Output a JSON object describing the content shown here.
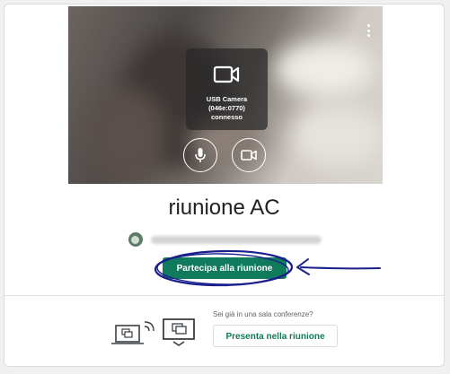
{
  "video": {
    "camera_name": "USB Camera",
    "camera_id": "(046e:0770)",
    "camera_status": "connesso",
    "mic_icon": "microphone-icon",
    "cam_icon": "video-camera-icon",
    "menu_icon": "more-vert-icon"
  },
  "meeting": {
    "title": "riunione AC"
  },
  "account": {
    "avatar_icon": "avatar"
  },
  "actions": {
    "join_label": "Partecipa alla riunione",
    "room_question": "Sei già in una sala conferenze?",
    "present_label": "Presenta nella riunione"
  },
  "colors": {
    "accent": "#0f7a5c",
    "annotation": "#1a1f8c"
  }
}
